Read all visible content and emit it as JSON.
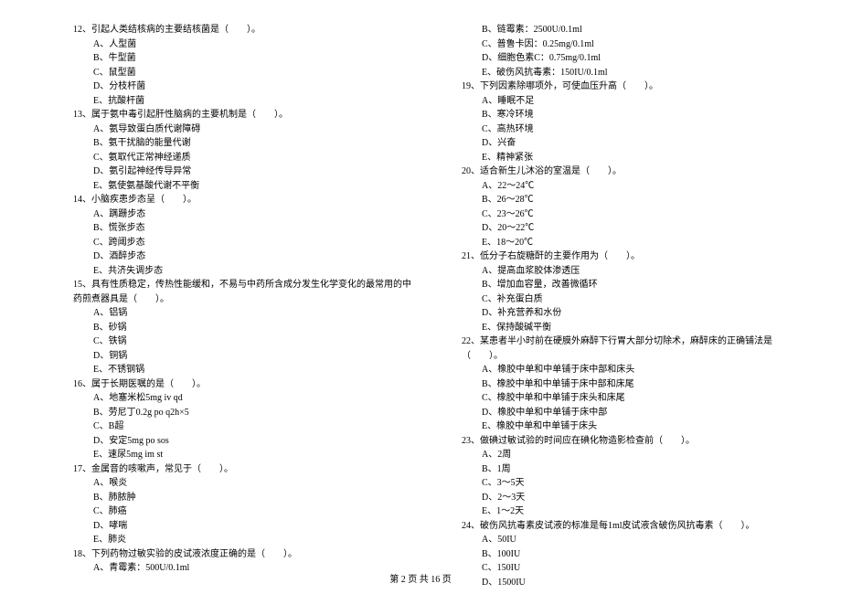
{
  "leftColumn": {
    "q12": {
      "text": "12、引起人类结核病的主要结核菌是（　　）。",
      "options": [
        "A、人型菌",
        "B、牛型菌",
        "C、鼠型菌",
        "D、分枝杆菌",
        "E、抗酸杆菌"
      ]
    },
    "q13": {
      "text": "13、属于氨中毒引起肝性脑病的主要机制是（　　）。",
      "options": [
        "A、氨导致蛋白质代谢障碍",
        "B、氨干扰脑的能量代谢",
        "C、氨取代正常神经递质",
        "D、氨引起神经传导异常",
        "E、氨使氨基酸代谢不平衡"
      ]
    },
    "q14": {
      "text": "14、小脑疾患步态呈（　　）。",
      "options": [
        "A、蹒跚步态",
        "B、慌张步态",
        "C、跨阈步态",
        "D、酒醉步态",
        "E、共济失调步态"
      ]
    },
    "q15": {
      "text": "15、具有性质稳定，传热性能缓和，不易与中药所含成分发生化学变化的最常用的中药煎煮器具是（　　）。",
      "options": [
        "A、铝锅",
        "B、砂锅",
        "C、铁锅",
        "D、铜锅",
        "E、不锈钢锅"
      ]
    },
    "q16": {
      "text": "16、属于长期医嘱的是（　　）。",
      "options": [
        "A、地塞米松5mg iv qd",
        "B、劳尼丁0.2g po q2h×5",
        "C、B超",
        "D、安定5mg po sos",
        "E、速尿5mg im st"
      ]
    },
    "q17": {
      "text": "17、金属音的咳嗽声，常见于（　　）。",
      "options": [
        "A、喉炎",
        "B、肺脓肿",
        "C、肺癌",
        "D、哮喘",
        "E、肺炎"
      ]
    },
    "q18": {
      "text": "18、下列药物过敏实验的皮试液浓度正确的是（　　）。",
      "options": [
        "A、青霉素：500U/0.1ml"
      ]
    }
  },
  "rightColumn": {
    "q18cont": {
      "options": [
        "B、链霉素：2500U/0.1ml",
        "C、普鲁卡因：0.25mg/0.1ml",
        "D、细胞色素C：0.75mg/0.1ml",
        "E、破伤风抗毒素：150IU/0.1ml"
      ]
    },
    "q19": {
      "text": "19、下列因素除哪项外，可使血压升高（　　）。",
      "options": [
        "A、睡眠不足",
        "B、寒冷环境",
        "C、高热环境",
        "D、兴奋",
        "E、精神紧张"
      ]
    },
    "q20": {
      "text": "20、适合新生儿沐浴的室温是（　　）。",
      "options": [
        "A、22～24℃",
        "B、26～28℃",
        "C、23～26℃",
        "D、20～22℃",
        "E、18～20℃"
      ]
    },
    "q21": {
      "text": "21、低分子右旋糖酐的主要作用为（　　）。",
      "options": [
        "A、提高血浆胶体渗透压",
        "B、增加血容量，改善微循环",
        "C、补充蛋白质",
        "D、补充营养和水份",
        "E、保持酸碱平衡"
      ]
    },
    "q22": {
      "text": "22、某患者半小时前在硬膜外麻醉下行胃大部分切除术，麻醉床的正确铺法是（　　）。",
      "options": [
        "A、橡胶中单和中单铺于床中部和床头",
        "B、橡胶中单和中单铺于床中部和床尾",
        "C、橡胶中单和中单铺于床头和床尾",
        "D、橡胶中单和中单铺于床中部",
        "E、橡胶中单和中单铺于床头"
      ]
    },
    "q23": {
      "text": "23、做碘过敏试验的时间应在碘化物造影检查前（　　）。",
      "options": [
        "A、2周",
        "B、1周",
        "C、3～5天",
        "D、2～3天",
        "E、1～2天"
      ]
    },
    "q24": {
      "text": "24、破伤风抗毒素皮试液的标准是每1ml皮试液含破伤风抗毒素（　　）。",
      "options": [
        "A、50IU",
        "B、100IU",
        "C、150IU",
        "D、1500IU"
      ]
    }
  },
  "footer": "第 2 页 共 16 页"
}
